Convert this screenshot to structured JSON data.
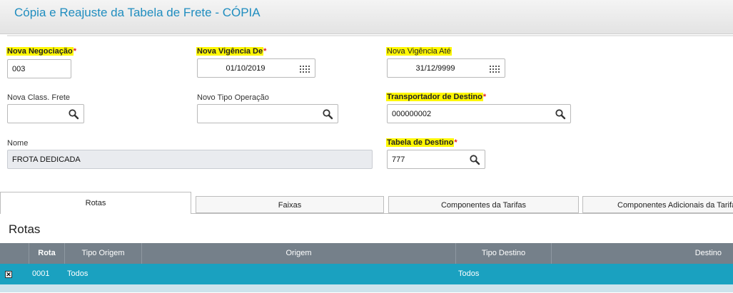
{
  "window": {
    "title": "Cópia e Reajuste da Tabela de Frete - CÓPIA"
  },
  "form": {
    "nova_negociacao": {
      "label": "Nova Negociação",
      "required": "*",
      "value": "003"
    },
    "nova_vigencia_de": {
      "label": "Nova Vigência De",
      "required": "*",
      "value": "01/10/2019"
    },
    "nova_vigencia_ate": {
      "label": "Nova Vigência Até",
      "value": "31/12/9999"
    },
    "nova_class_frete": {
      "label": "Nova Class. Frete",
      "value": ""
    },
    "novo_tipo_operacao": {
      "label": "Novo Tipo Operação",
      "value": ""
    },
    "transportador_destino": {
      "label": "Transportador de Destino",
      "required": "*",
      "value": "000000002"
    },
    "nome": {
      "label": "Nome",
      "value": "FROTA DEDICADA"
    },
    "tabela_destino": {
      "label": "Tabela de Destino",
      "required": "*",
      "value": "777"
    }
  },
  "tabs": [
    {
      "label": "Rotas"
    },
    {
      "label": "Faixas"
    },
    {
      "label": "Componentes da Tarifas"
    },
    {
      "label": "Componentes Adicionais da Tarifa"
    }
  ],
  "rotas": {
    "title": "Rotas",
    "columns": [
      "Rota",
      "Tipo Origem",
      "Origem",
      "Tipo Destino",
      "Destino"
    ],
    "rows": [
      {
        "rota": "0001",
        "tipo_origem": "Todos",
        "origem": "",
        "tipo_destino": "Todos",
        "destino": ""
      }
    ]
  },
  "colors": {
    "accent": "#1f8dbf",
    "highlight": "#fff700",
    "selected_row": "#1aa1c0",
    "grid_header": "#75808a"
  }
}
